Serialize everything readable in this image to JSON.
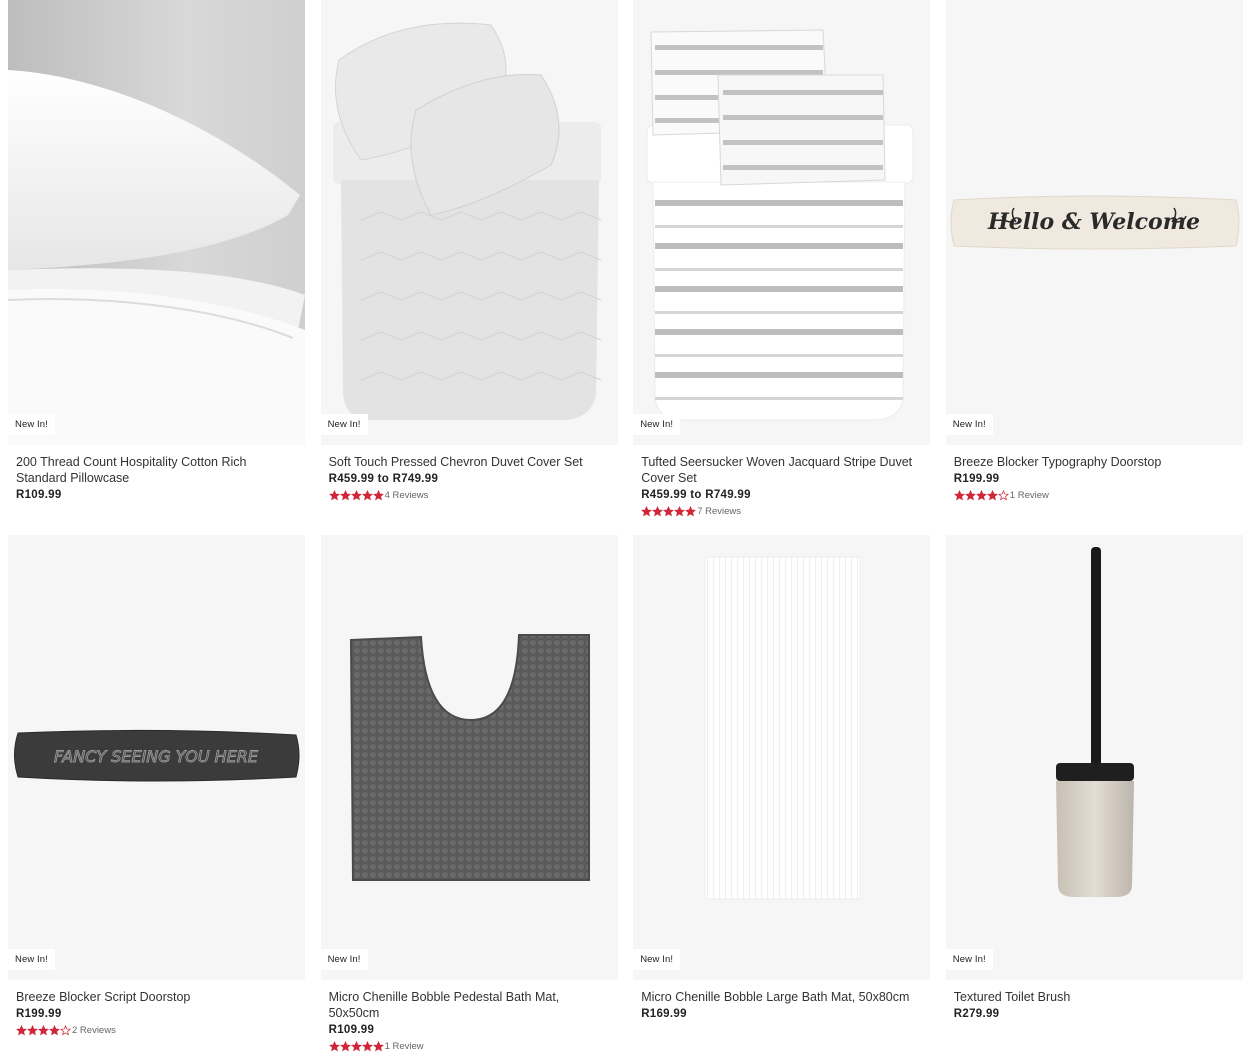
{
  "colors": {
    "star": "#d0263a",
    "badge_bg": "#ffffff",
    "tile_bg": "#f6f6f6"
  },
  "products": [
    {
      "badge": "New In!",
      "name": "200 Thread Count Hospitality Cotton Rich Standard Pillowcase",
      "price": "R109.99",
      "rating": null,
      "reviews": null,
      "image": "pillowcase-icon"
    },
    {
      "badge": "New In!",
      "name": "Soft Touch Pressed Chevron Duvet Cover Set",
      "price": "R459.99 to R749.99",
      "rating": 5,
      "reviews": "4 Reviews",
      "image": "duvet-chevron-icon"
    },
    {
      "badge": "New In!",
      "name": "Tufted Seersucker Woven Jacquard Stripe Duvet Cover Set",
      "price": "R459.99 to R749.99",
      "rating": 5,
      "reviews": "7 Reviews",
      "image": "duvet-stripe-icon"
    },
    {
      "badge": "New In!",
      "name": "Breeze Blocker Typography Doorstop",
      "price": "R199.99",
      "rating": 4,
      "reviews": "1 Review",
      "image": "doorstop-hello-icon",
      "image_text": "Hello & Welcome"
    },
    {
      "badge": "New In!",
      "name": "Breeze Blocker Script Doorstop",
      "price": "R199.99",
      "rating": 4,
      "reviews": "2 Reviews",
      "image": "doorstop-script-icon",
      "image_text": "FANCY SEEING YOU HERE"
    },
    {
      "badge": "New In!",
      "name": "Micro Chenille Bobble Pedestal Bath Mat, 50x50cm",
      "price": "R109.99",
      "rating": 5,
      "reviews": "1 Review",
      "image": "pedestal-mat-icon"
    },
    {
      "badge": "New In!",
      "name": "Micro Chenille Bobble Large Bath Mat, 50x80cm",
      "price": "R169.99",
      "rating": null,
      "reviews": null,
      "image": "bath-mat-icon"
    },
    {
      "badge": "New In!",
      "name": "Textured Toilet Brush",
      "price": "R279.99",
      "rating": null,
      "reviews": null,
      "image": "toilet-brush-icon"
    }
  ]
}
